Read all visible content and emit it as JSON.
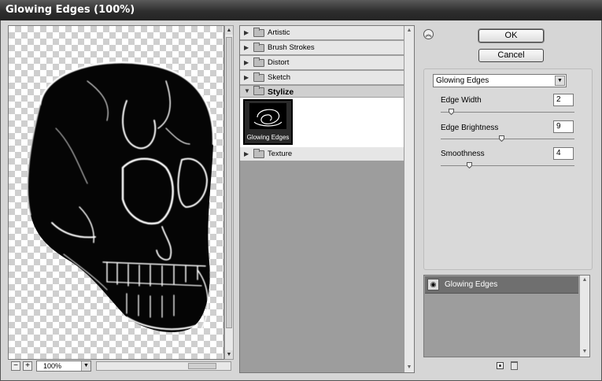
{
  "window": {
    "title": "Glowing Edges (100%)"
  },
  "preview": {
    "zoom_minus": "−",
    "zoom_plus": "+",
    "zoom_value": "100%"
  },
  "gallery": {
    "categories": [
      {
        "label": "Artistic",
        "expanded": false
      },
      {
        "label": "Brush Strokes",
        "expanded": false
      },
      {
        "label": "Distort",
        "expanded": false
      },
      {
        "label": "Sketch",
        "expanded": false
      },
      {
        "label": "Stylize",
        "expanded": true
      },
      {
        "label": "Texture",
        "expanded": false
      }
    ],
    "stylize_thumbnails": [
      {
        "label": "Glowing Edges",
        "selected": true
      }
    ]
  },
  "buttons": {
    "ok": "OK",
    "cancel": "Cancel"
  },
  "settings": {
    "filter_select": "Glowing Edges",
    "params": [
      {
        "label": "Edge Width",
        "value": "2",
        "min": 1,
        "max": 14,
        "level": 2
      },
      {
        "label": "Edge Brightness",
        "value": "9",
        "min": 0,
        "max": 20,
        "level": 9
      },
      {
        "label": "Smoothness",
        "value": "4",
        "min": 1,
        "max": 15,
        "level": 4
      }
    ]
  },
  "layers": [
    {
      "name": "Glowing Edges",
      "visible": true,
      "icon": "eye-icon"
    }
  ],
  "icons": {
    "collapse": "double-chevron-up-icon",
    "expand_tri": "triangle-right-icon",
    "open_tri": "triangle-down-icon",
    "folder": "folder-icon",
    "new_layer": "new-effect-layer-icon",
    "delete": "trash-icon"
  }
}
